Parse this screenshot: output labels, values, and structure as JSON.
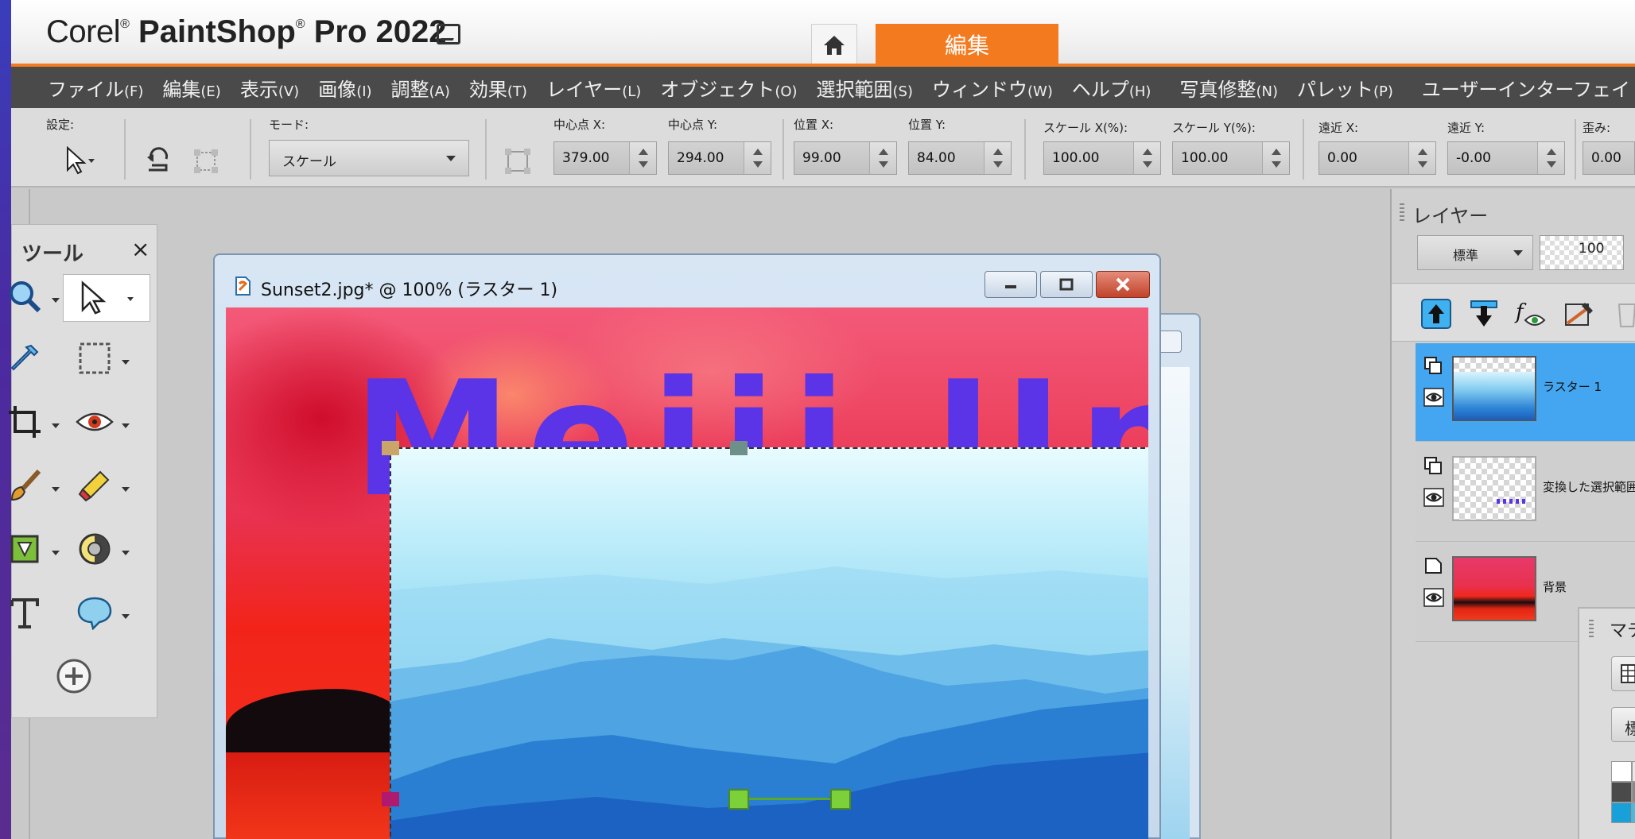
{
  "title_bar": {
    "brand_corel": "Corel",
    "brand_product": "PaintShop",
    "brand_pro": "Pro 2022",
    "tab_edit": "編集"
  },
  "menu": [
    {
      "label": "ファイル",
      "key": "(F)"
    },
    {
      "label": "編集",
      "key": "(E)"
    },
    {
      "label": "表示",
      "key": "(V)"
    },
    {
      "label": "画像",
      "key": "(I)"
    },
    {
      "label": "調整",
      "key": "(A)"
    },
    {
      "label": "効果",
      "key": "(T)"
    },
    {
      "label": "レイヤー",
      "key": "(L)"
    },
    {
      "label": "オブジェクト",
      "key": "(O)"
    },
    {
      "label": "選択範囲",
      "key": "(S)"
    },
    {
      "label": "ウィンドウ",
      "key": "(W)"
    },
    {
      "label": "ヘルプ",
      "key": "(H)"
    },
    {
      "label": "写真修整",
      "key": "(N)"
    },
    {
      "label": "パレット",
      "key": "(P)"
    },
    {
      "label": "ユーザーインターフェイ",
      "key": ""
    }
  ],
  "options": {
    "settings_label": "設定:",
    "mode_label": "モード:",
    "mode_value": "スケール",
    "center_x_label": "中心点 X:",
    "center_x": "379.00",
    "center_y_label": "中心点 Y:",
    "center_y": "294.00",
    "pos_x_label": "位置 X:",
    "pos_x": "99.00",
    "pos_y_label": "位置 Y:",
    "pos_y": "84.00",
    "scale_x_label": "スケール X(%):",
    "scale_x": "100.00",
    "scale_y_label": "スケール Y(%):",
    "scale_y": "100.00",
    "persp_x_label": "遠近 X:",
    "persp_x": "0.00",
    "persp_y_label": "遠近 Y:",
    "persp_y": "-0.00",
    "skew_label": "歪み:",
    "skew": "0.00"
  },
  "tools_panel": {
    "title": "ツール",
    "close": "×"
  },
  "document": {
    "title": "Sunset2.jpg* @ 100% (ラスター 1)",
    "canvas_text": "Meiji Univ"
  },
  "layers_panel": {
    "title": "レイヤー",
    "blend_mode": "標準",
    "opacity": "100",
    "layers": [
      {
        "name": "ラスター 1",
        "selected": true
      },
      {
        "name": "変換した選択範囲",
        "selected": false
      },
      {
        "name": "背景",
        "selected": false
      }
    ]
  },
  "materials_panel": {
    "title": "マテリアル",
    "button_label": "標"
  },
  "colors": {
    "accent_orange": "#f47a20",
    "menu_bg": "#4a4a4a",
    "layer_selected": "#44a6f0"
  }
}
